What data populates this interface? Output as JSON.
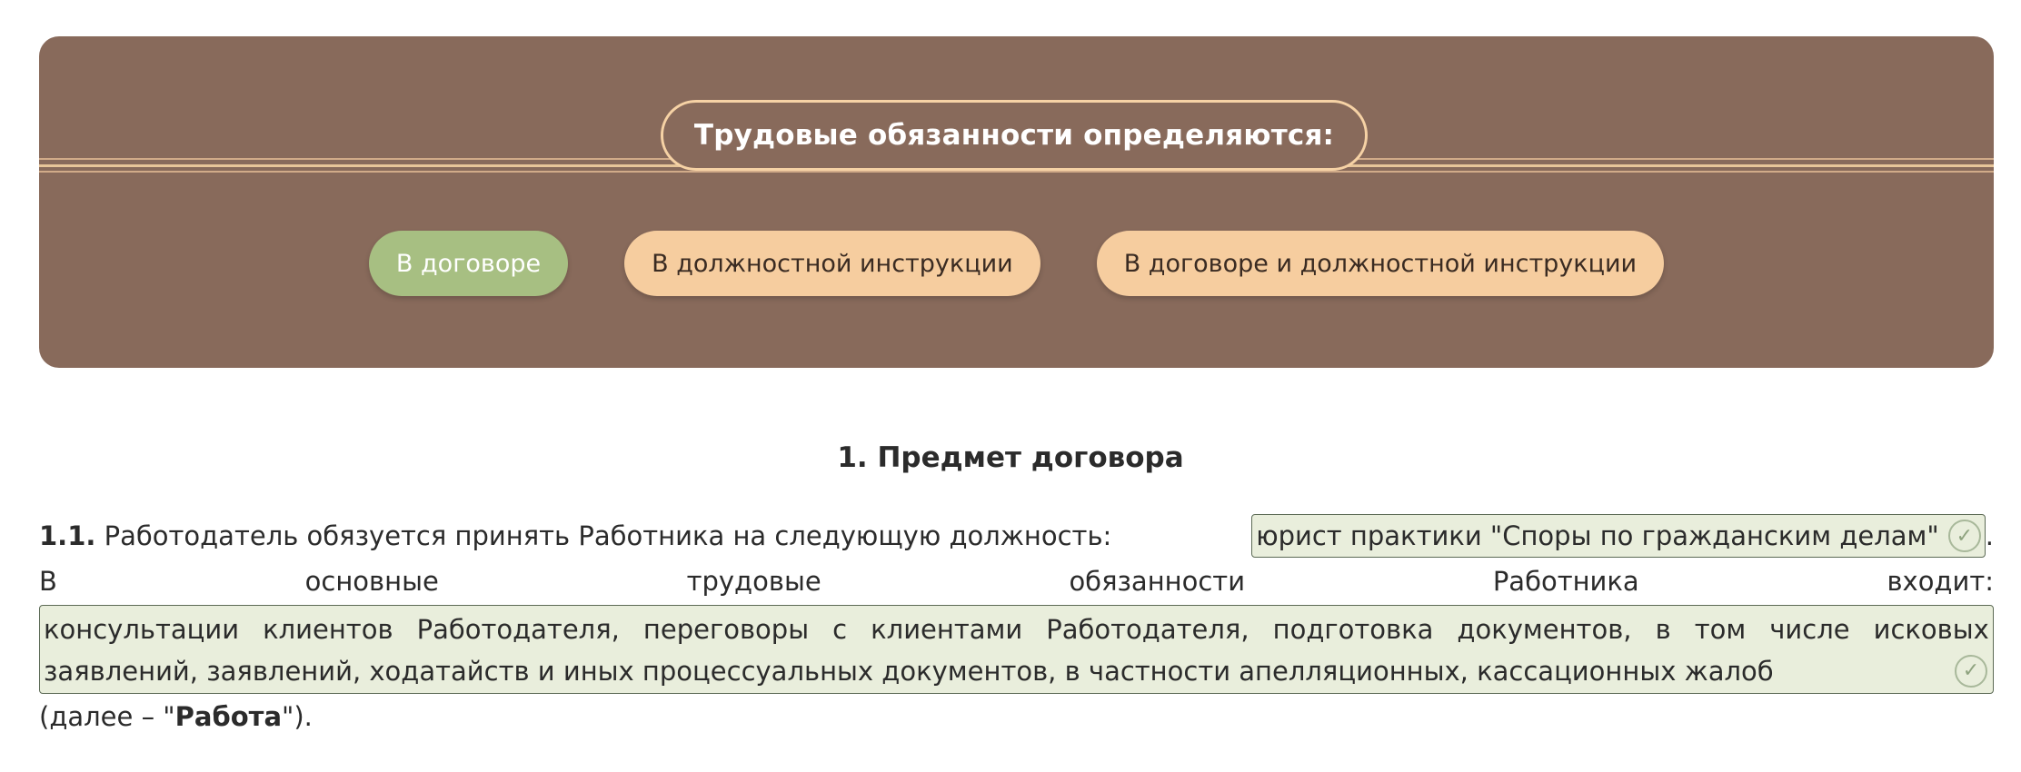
{
  "question": {
    "title": "Трудовые обязанности определяются:",
    "options": [
      {
        "label": "В договоре",
        "selected": true
      },
      {
        "label": "В должностной инструкции",
        "selected": false
      },
      {
        "label": "В договоре и должностной инструкции",
        "selected": false
      }
    ]
  },
  "document": {
    "section_title": "1. Предмет договора",
    "clause_number": "1.1.",
    "clause_lead": "Работодатель обязуется принять Работника на следующую должность:",
    "position_value": "юрист практики \"Споры по гражданским делам\"",
    "position_suffix": ".",
    "duties_words": [
      "В",
      "основные",
      "трудовые",
      "обязанности",
      "Работника",
      "входит:"
    ],
    "duties_row1_words": [
      "консультации",
      "клиентов",
      "Работодателя,",
      "переговоры",
      "с",
      "клиентами",
      "Работодателя,",
      "подготовка",
      "документов,",
      "в",
      "том",
      "числе",
      "исковых"
    ],
    "duties_row2": "заявлений, заявлений, ходатайств и иных процессуальных документов, в частности апелляционных, кассационных жалоб",
    "tail_prefix": "(далее – \"",
    "tail_bold": "Работа",
    "tail_suffix": "\")."
  },
  "colors": {
    "panel": "#886a5b",
    "option": "#f6cd9f",
    "option_selected": "#a7bf82",
    "fill_bg": "#e9eedc"
  },
  "icons": {
    "check": "check-circle-icon"
  }
}
